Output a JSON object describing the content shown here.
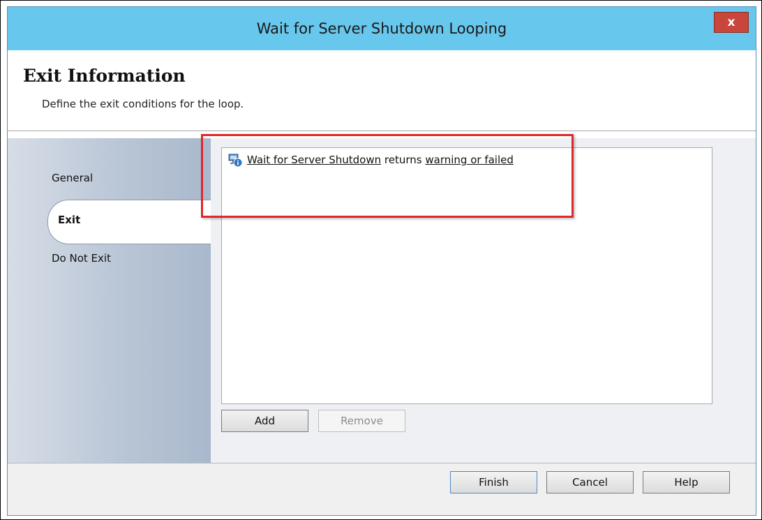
{
  "window": {
    "title": "Wait for Server Shutdown Looping",
    "close_label": "x"
  },
  "header": {
    "title": "Exit Information",
    "subtitle": "Define the exit conditions for the loop."
  },
  "sidebar": {
    "items": [
      {
        "label": "General",
        "selected": false
      },
      {
        "label": "Exit",
        "selected": true
      },
      {
        "label": "Do Not Exit",
        "selected": false
      }
    ]
  },
  "conditions": [
    {
      "icon": "activity-info-icon",
      "activity": "Wait for Server Shutdown",
      "verb": "returns",
      "status": "warning or failed"
    }
  ],
  "list_buttons": {
    "add": "Add",
    "remove": "Remove"
  },
  "footer_buttons": {
    "finish": "Finish",
    "cancel": "Cancel",
    "help": "Help"
  },
  "colors": {
    "titlebar": "#67c7ec",
    "close": "#c9463d",
    "highlight": "#e0272b"
  }
}
